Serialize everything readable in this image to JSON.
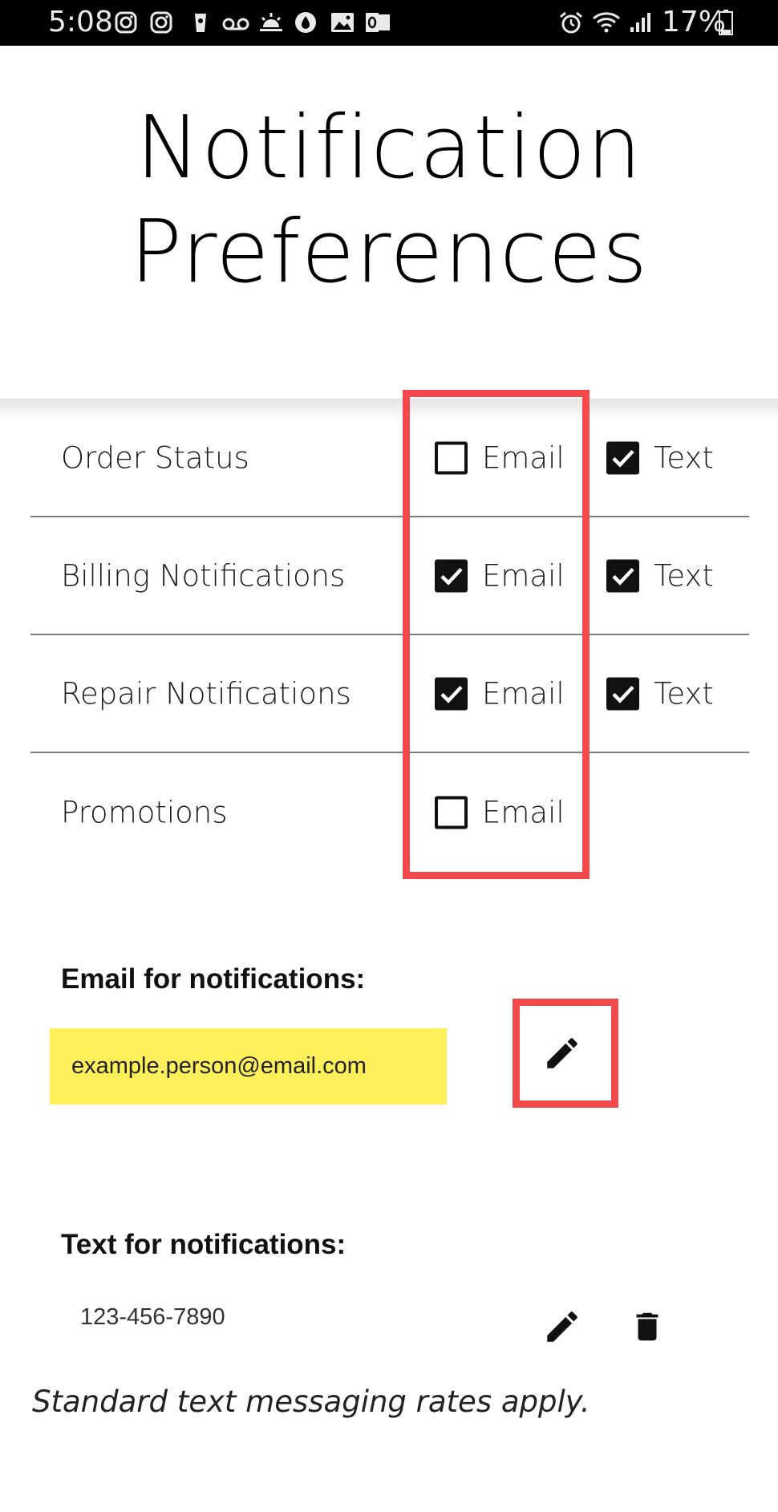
{
  "status_bar": {
    "time": "5:08",
    "battery": "17%",
    "icons": [
      "instagram-icon",
      "instagram-icon",
      "cup-icon",
      "voicemail-icon",
      "sunrise-icon",
      "drop-icon",
      "image-icon",
      "outlook-icon",
      "alarm-icon",
      "wifi-icon",
      "signal-icon",
      "battery-icon"
    ]
  },
  "page": {
    "title_line1": "Notification",
    "title_line2": "Preferences"
  },
  "preferences": [
    {
      "label": "Order Status",
      "email_label": "Email",
      "email_checked": false,
      "text_label": "Text",
      "text_checked": true
    },
    {
      "label": "Billing Notifications",
      "email_label": "Email",
      "email_checked": true,
      "text_label": "Text",
      "text_checked": true
    },
    {
      "label": "Repair Notifications",
      "email_label": "Email",
      "email_checked": true,
      "text_label": "Text",
      "text_checked": true
    },
    {
      "label": "Promotions",
      "email_label": "Email",
      "email_checked": false
    }
  ],
  "email_section": {
    "label": "Email for notifications:",
    "value": "example.person@email.com",
    "edit_icon": "pencil-icon"
  },
  "text_section": {
    "label": "Text for notifications:",
    "value": "123-456-7890",
    "edit_icon": "pencil-icon",
    "delete_icon": "trash-icon"
  },
  "footnote": "Standard text messaging rates apply.",
  "colors": {
    "highlight": "#f3494b",
    "email_field_bg": "#fdf05a",
    "checkbox": "#111111",
    "status_bar_bg": "#000000"
  }
}
